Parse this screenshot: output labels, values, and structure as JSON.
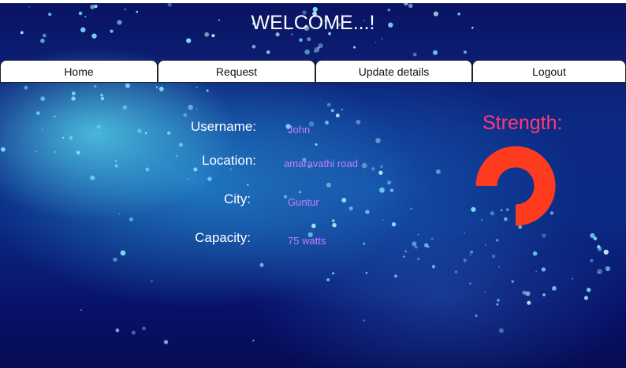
{
  "page": {
    "title": "WELCOME...!"
  },
  "nav": {
    "tabs": [
      {
        "label": "Home"
      },
      {
        "label": "Request"
      },
      {
        "label": "Update details"
      },
      {
        "label": "Logout"
      }
    ]
  },
  "profile": {
    "username": {
      "label": "Username:",
      "value": "John"
    },
    "location": {
      "label": "Location:",
      "value": "amaravathi road"
    },
    "city": {
      "label": "City:",
      "value": "Guntur"
    },
    "capacity": {
      "label": "Capacity:",
      "value": "75 watts"
    }
  },
  "strength": {
    "label": "Strength:",
    "level": 0.75,
    "color": "#ff3b1f"
  },
  "colors": {
    "title": "#ffffff",
    "label": "#ffffff",
    "value": "#c77dff",
    "strength_label": "#ff3a73"
  }
}
